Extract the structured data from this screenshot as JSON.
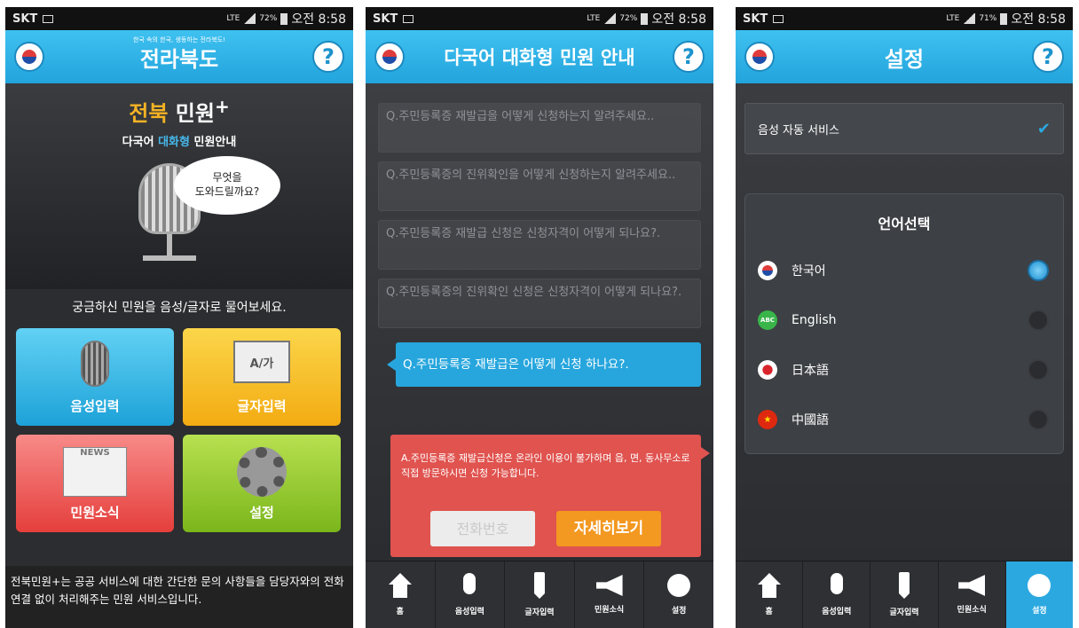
{
  "status": {
    "carrier": "SKT",
    "phone1": {
      "network": "LTE",
      "battery": "72%",
      "time": "오전 8:58"
    },
    "phone2": {
      "network": "LTE",
      "battery": "72%",
      "time": "오전 8:58"
    },
    "phone3": {
      "network": "LTE",
      "battery": "71%",
      "time": "오전 8:58"
    }
  },
  "home": {
    "slogan": "한국 속의 한국, 생동하는 전라북도!",
    "title": "전라북도",
    "help": "?",
    "brand_part1": "전북",
    "brand_part2": " 민원",
    "brand_sup": "+",
    "brand_sub_part1": "다국어 ",
    "brand_sub_highlight": "대화형",
    "brand_sub_part2": " 민원안내",
    "bubble": "무엇을\n도와드릴까요?",
    "prompt": "궁금하신 민원을 음성/글자로 물어보세요.",
    "tiles": {
      "voice": "음성입력",
      "text": "글자입력",
      "text_icon": "A/가",
      "news": "민원소식",
      "news_icon": "NEWS",
      "settings": "설정"
    },
    "footer": "전북민원+는 공공 서비스에 대한 간단한 문의 사항들을 담당자와의 전화 연결 없이 처리해주는 민원 서비스입니다."
  },
  "guide": {
    "title": "다국어 대화형 민원 안내",
    "help": "?",
    "questions": [
      "Q.주민등록증 재발급을 어떻게 신청하는지 알려주세요..",
      "Q.주민등록증의 진위확인을 어떻게 신청하는지 알려주세요..",
      "Q.주민등록증 재발급 신청은 신청자격이 어떻게 되나요?.",
      "Q.주민등록증의 진위확인 신청은 신청자격이 어떻게 되나요?."
    ],
    "active_question": "Q.주민등록증 재발급은 어떻게 신청 하나요?.",
    "answer": "A.주민등록증 재발급신청은 온라인 이용이 불가하며 읍, 면, 동사무소로 직접 방문하시면 신청 가능합니다.",
    "phone_button": "전화번호",
    "detail_button": "자세히보기"
  },
  "tabs": {
    "home": "홈",
    "voice": "음성입력",
    "text": "글자입력",
    "news": "민원소식",
    "settings": "설정"
  },
  "settings": {
    "title": "설정",
    "help": "?",
    "auto_voice": "음성 자동 서비스",
    "language_title": "언어선택",
    "languages": [
      {
        "label": "한국어",
        "icon": "korea-flag-icon",
        "selected": true
      },
      {
        "label": "English",
        "icon": "abc-icon",
        "icon_text": "ABC",
        "selected": false
      },
      {
        "label": "日本語",
        "icon": "japan-flag-icon",
        "selected": false
      },
      {
        "label": "中國語",
        "icon": "china-flag-icon",
        "selected": false
      }
    ]
  },
  "colors": {
    "appbar": "#22a4dd",
    "active_tab": "#2ba8e0",
    "answer": "#e0534f",
    "detail_button": "#f39821"
  }
}
